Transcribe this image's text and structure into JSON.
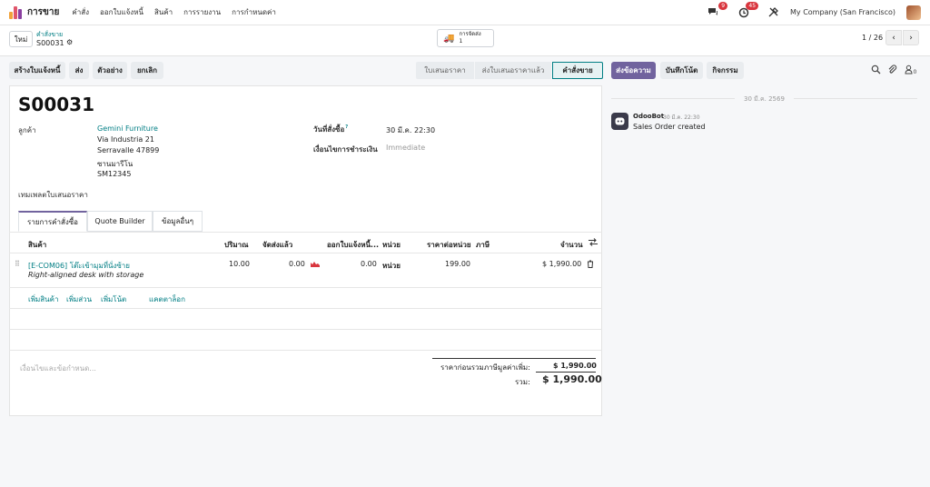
{
  "topbar": {
    "app_name": "การขาย",
    "menu": [
      "คำสั่ง",
      "ออกใบแจ้งหนี้",
      "สินค้า",
      "การรายงาน",
      "การกำหนดค่า"
    ],
    "messages_badge": "9",
    "activities_badge": "45",
    "company": "My Company (San Francisco)",
    "colors": {
      "accent": "#71639e",
      "link": "#017e84",
      "badge": "#d9363e"
    }
  },
  "control": {
    "new_label": "ใหม่",
    "breadcrumb_parent": "คำสั่งขาย",
    "breadcrumb_current": "S00031",
    "delivery_label": "การจัดส่ง",
    "delivery_count": "1",
    "pager": "1 / 26"
  },
  "actions": {
    "create_invoice": "สร้างใบแจ้งหนี้",
    "send": "ส่ง",
    "preview": "ตัวอย่าง",
    "cancel": "ยกเลิก"
  },
  "status": {
    "quotation": "ใบเสนอราคา",
    "quotation_sent": "ส่งใบเสนอราคาแล้ว",
    "sales_order": "คำสั่งขาย"
  },
  "order": {
    "name": "S00031",
    "customer_label": "ลูกค้า",
    "customer_name": "Gemini Furniture",
    "address": [
      "Via Industria 21",
      "Serravalle 47899",
      "ซานมารีโน",
      "SM12345"
    ],
    "order_date_label": "วันที่สั่งซื้อ",
    "order_date_help": "?",
    "order_date": "30 มี.ค. 22:30",
    "payment_terms_label": "เงื่อนไขการชำระเงิน",
    "payment_terms_placeholder": "Immediate",
    "quote_template_label": "เทมเพลตใบเสนอราคา"
  },
  "tabs": [
    "รายการคำสั่งซื้อ",
    "Quote Builder",
    "ข้อมูลอื่นๆ"
  ],
  "table": {
    "headers": [
      "สินค้า",
      "ปริมาณ",
      "จัดส่งแล้ว",
      "ออกใบแจ้งหนี้...",
      "หน่วย",
      "ราคาต่อหน่วย",
      "ภาษี",
      "จำนวน"
    ],
    "rows": [
      {
        "product": "[E-COM06] โต๊ะเข้ามุมที่นั่งซ้าย",
        "description": "Right-aligned desk with storage",
        "qty": "10.00",
        "delivered": "0.00",
        "invoiced": "0.00",
        "uom": "หน่วย",
        "price": "199.00",
        "tax": "",
        "amount": "$ 1,990.00"
      }
    ],
    "add_product": "เพิ่มสินค้า",
    "add_section": "เพิ่มส่วน",
    "add_note": "เพิ่มโน้ต",
    "catalog": "แคตตาล็อก"
  },
  "totals": {
    "terms_placeholder": "เงื่อนไขและข้อกำหนด...",
    "untaxed_label": "ราคาก่อนรวมภาษีมูลค่าเพิ่ม:",
    "untaxed_value": "$ 1,990.00",
    "total_label": "รวม:",
    "total_value": "$ 1,990.00"
  },
  "chatter": {
    "send_message": "ส่งข้อความ",
    "log_note": "บันทึกโน้ต",
    "activity": "กิจกรรม",
    "date_separator": "30 มี.ค. 2569",
    "author": "OdooBot",
    "time": "30 มี.ค. 22:30",
    "message": "Sales Order created"
  }
}
